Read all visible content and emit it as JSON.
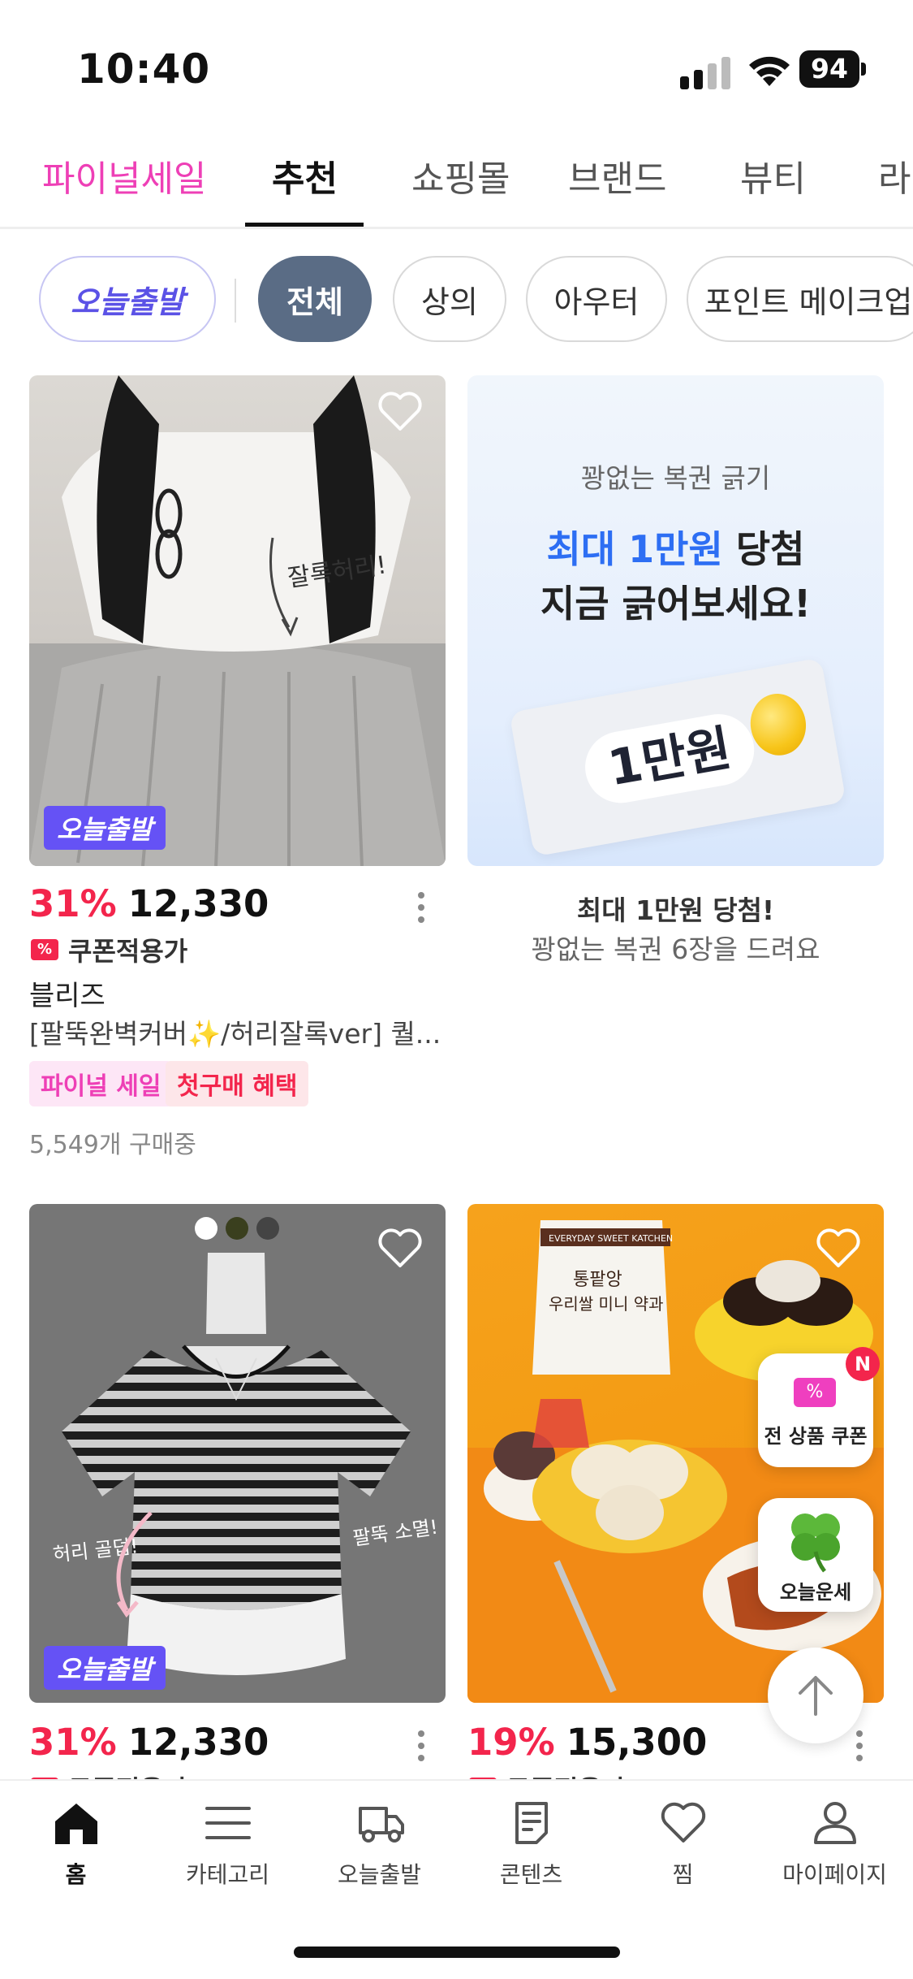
{
  "status_bar": {
    "time": "10:40",
    "battery": "94"
  },
  "top_tabs": [
    {
      "label": "파이널세일"
    },
    {
      "label": "추천"
    },
    {
      "label": "쇼핑몰"
    },
    {
      "label": "브랜드"
    },
    {
      "label": "뷰티"
    },
    {
      "label": "라"
    }
  ],
  "chips": [
    {
      "label": "오늘출발"
    },
    {
      "label": "전체"
    },
    {
      "label": "상의"
    },
    {
      "label": "아우터"
    },
    {
      "label": "포인트 메이크업"
    }
  ],
  "product1": {
    "badge": "오늘출발",
    "image_text": "잘록허리!",
    "discount": "31%",
    "price": "12,330",
    "coupon": "쿠폰적용가",
    "brand": "블리즈",
    "name": "[팔뚝완벽커버✨/허리잘록ver] 퀄...",
    "tags": [
      "파이널 세일",
      "첫구매 혜택"
    ],
    "buying": "5,549개 구매중"
  },
  "ad": {
    "sub": "꽝없는 복권 긁기",
    "line1_blue": "최대 1만원",
    "line1_rest": " 당첨",
    "line2": "지금 긁어보세요!",
    "ticket_label": "1만원",
    "caption1": "최대 1만원 당첨!",
    "caption2": "꽝없는 복권 6장을 드려요"
  },
  "product2": {
    "badge": "오늘출발",
    "note_left": "허리 골덥!",
    "note_right": "팔뚝 소멸!",
    "discount": "31%",
    "price": "12,330",
    "coupon": "쿠폰적용가"
  },
  "product3": {
    "pack_label": "EVERYDAY SWEET KATCHEN",
    "pack_title1": "통팥앙",
    "pack_title2": "우리쌀 미니 약과",
    "discount": "19%",
    "price": "15,300",
    "coupon": "쿠폰적용가"
  },
  "floating": {
    "coupon_label": "전 상품 쿠폰",
    "coupon_badge": "N",
    "luck_label": "오늘운세"
  },
  "bottom_nav": [
    {
      "label": "홈",
      "icon": "home-icon"
    },
    {
      "label": "카테고리",
      "icon": "menu-icon"
    },
    {
      "label": "오늘출발",
      "icon": "truck-icon"
    },
    {
      "label": "콘텐츠",
      "icon": "document-icon"
    },
    {
      "label": "찜",
      "icon": "heart-icon"
    },
    {
      "label": "마이페이지",
      "icon": "person-icon"
    }
  ],
  "colors": {
    "accent_pink": "#ee3fb6",
    "discount_red": "#f3254c",
    "today_purple": "#6552f5",
    "chip_active": "#5a6c85"
  }
}
